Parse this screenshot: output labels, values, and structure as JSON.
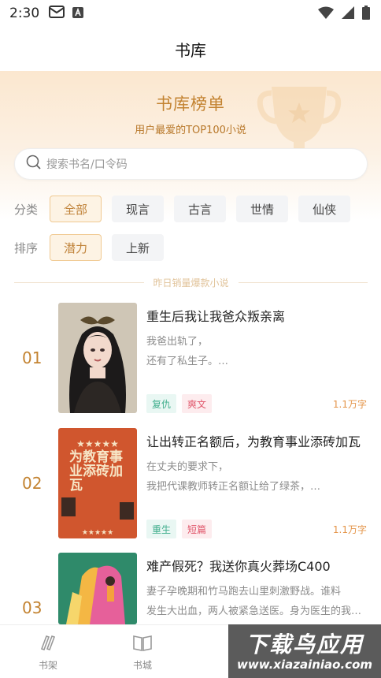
{
  "status_bar": {
    "time": "2:30",
    "icons": [
      "mail-icon",
      "a-box-icon",
      "wifi-icon",
      "signal-icon",
      "battery-icon"
    ]
  },
  "header": {
    "title": "书库"
  },
  "banner": {
    "title": "书库榜单",
    "subtitle": "用户最爱的TOP100小说",
    "icon": "trophy-icon"
  },
  "search": {
    "placeholder": "搜索书名/口令码",
    "icon": "search-icon"
  },
  "filters": {
    "category": {
      "label": "分类",
      "options": [
        "全部",
        "现言",
        "古言",
        "世情",
        "仙侠"
      ],
      "selected": "全部"
    },
    "sort": {
      "label": "排序",
      "options": [
        "潜力",
        "上新"
      ],
      "selected": "潜力"
    }
  },
  "section_divider": "昨日销量爆款小说",
  "books": [
    {
      "rank": "01",
      "title": "重生后我让我爸众叛亲离",
      "desc_line1": "我爸出轨了，",
      "desc_line2": "还有了私生子。…",
      "tags": [
        "复仇",
        "爽文"
      ],
      "words": "1.1万字"
    },
    {
      "rank": "02",
      "title": "让出转正名额后，为教育事业添砖加瓦",
      "desc_line1": "在丈夫的要求下，",
      "desc_line2": "我把代课教师转正名额让给了绿茶，…",
      "tags": [
        "重生",
        "短篇"
      ],
      "words": "1.1万字",
      "cover_text": "为教育事业添砖加瓦"
    },
    {
      "rank": "03",
      "title": "难产假死？我送你真火葬场C400",
      "desc_line1": "妻子孕晚期和竹马跑去山里刺激野战。谁料",
      "desc_line2": "发生大出血，两人被紧急送医。身为医生的我…",
      "tags": [],
      "words": ""
    }
  ],
  "bottom_nav": [
    {
      "label": "书架",
      "icon": "bookshelf-icon"
    },
    {
      "label": "书城",
      "icon": "book-open-icon"
    }
  ],
  "watermark": {
    "main": "下载鸟应用",
    "url": "www.xiazainiao.com"
  },
  "colors": {
    "accent": "#c38331",
    "chip_active_bg": "#fdf3e4",
    "chip_bg": "#f3f4f6",
    "tag_green": "#3fae8c",
    "tag_red": "#e0576b",
    "word_count": "#e4954a"
  }
}
